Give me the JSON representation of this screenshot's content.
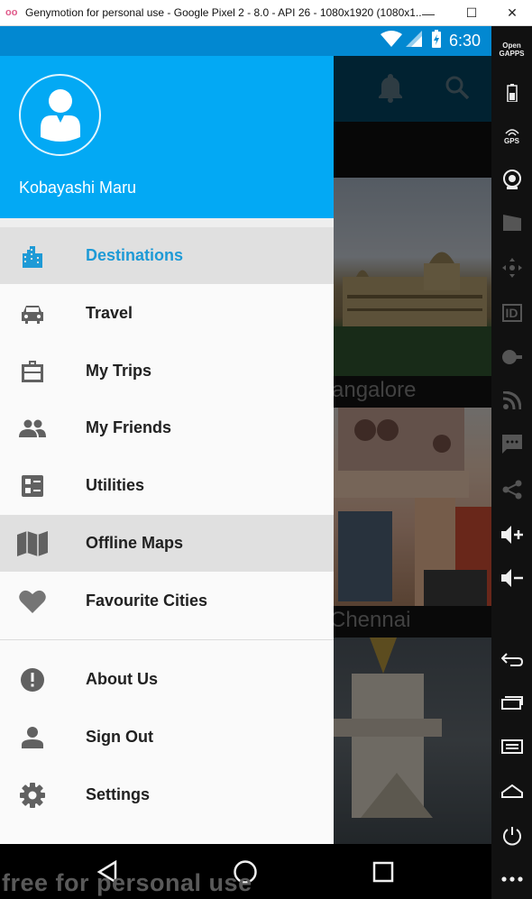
{
  "window": {
    "title": "Genymotion for personal use - Google Pixel 2 - 8.0 - API 26 - 1080x1920 (1080x1...",
    "logo_text": "oo",
    "minimize_label": "—",
    "maximize_label": "☐",
    "close_label": "✕"
  },
  "status_bar": {
    "time": "6:30",
    "icons": [
      "wifi-icon",
      "signal-icon",
      "battery-charging-icon"
    ],
    "color": "#0288d1"
  },
  "toolbar": {
    "open_gapps_top": "Open",
    "open_gapps_bottom": "GAPPS",
    "gps_label": "GPS",
    "id_label": "ID",
    "items": [
      "battery",
      "gps",
      "camera",
      "capture",
      "remote-control",
      "identifiers",
      "disk-io",
      "network",
      "sms",
      "share",
      "volume-up",
      "volume-down",
      "back",
      "recent-apps",
      "menu",
      "home",
      "power",
      "more"
    ]
  },
  "app": {
    "appbar_color": "#023f5a",
    "appbar_icons": [
      "bell-icon",
      "search-icon"
    ],
    "cities": [
      {
        "label": "angalore"
      },
      {
        "label": "Chennai"
      },
      {
        "label": "..."
      }
    ]
  },
  "drawer": {
    "header_color": "#03a9f4",
    "user_name": "Kobayashi Maru",
    "accent": "#1e9ad6",
    "items": [
      {
        "label": "Destinations",
        "icon": "city-icon",
        "selected": true
      },
      {
        "label": "Travel",
        "icon": "car-icon"
      },
      {
        "label": "My Trips",
        "icon": "briefcase-icon"
      },
      {
        "label": "My Friends",
        "icon": "people-icon"
      },
      {
        "label": "Utilities",
        "icon": "list-icon"
      },
      {
        "label": "Offline Maps",
        "icon": "map-icon",
        "highlighted": true
      },
      {
        "label": "Favourite Cities",
        "icon": "heart-icon"
      },
      {
        "label": "About Us",
        "icon": "info-icon"
      },
      {
        "label": "Sign Out",
        "icon": "person-icon"
      },
      {
        "label": "Settings",
        "icon": "gear-icon"
      }
    ]
  },
  "nav_bar": {
    "buttons": [
      "back-icon",
      "home-icon",
      "recents-icon"
    ]
  },
  "watermark": "free for personal use"
}
